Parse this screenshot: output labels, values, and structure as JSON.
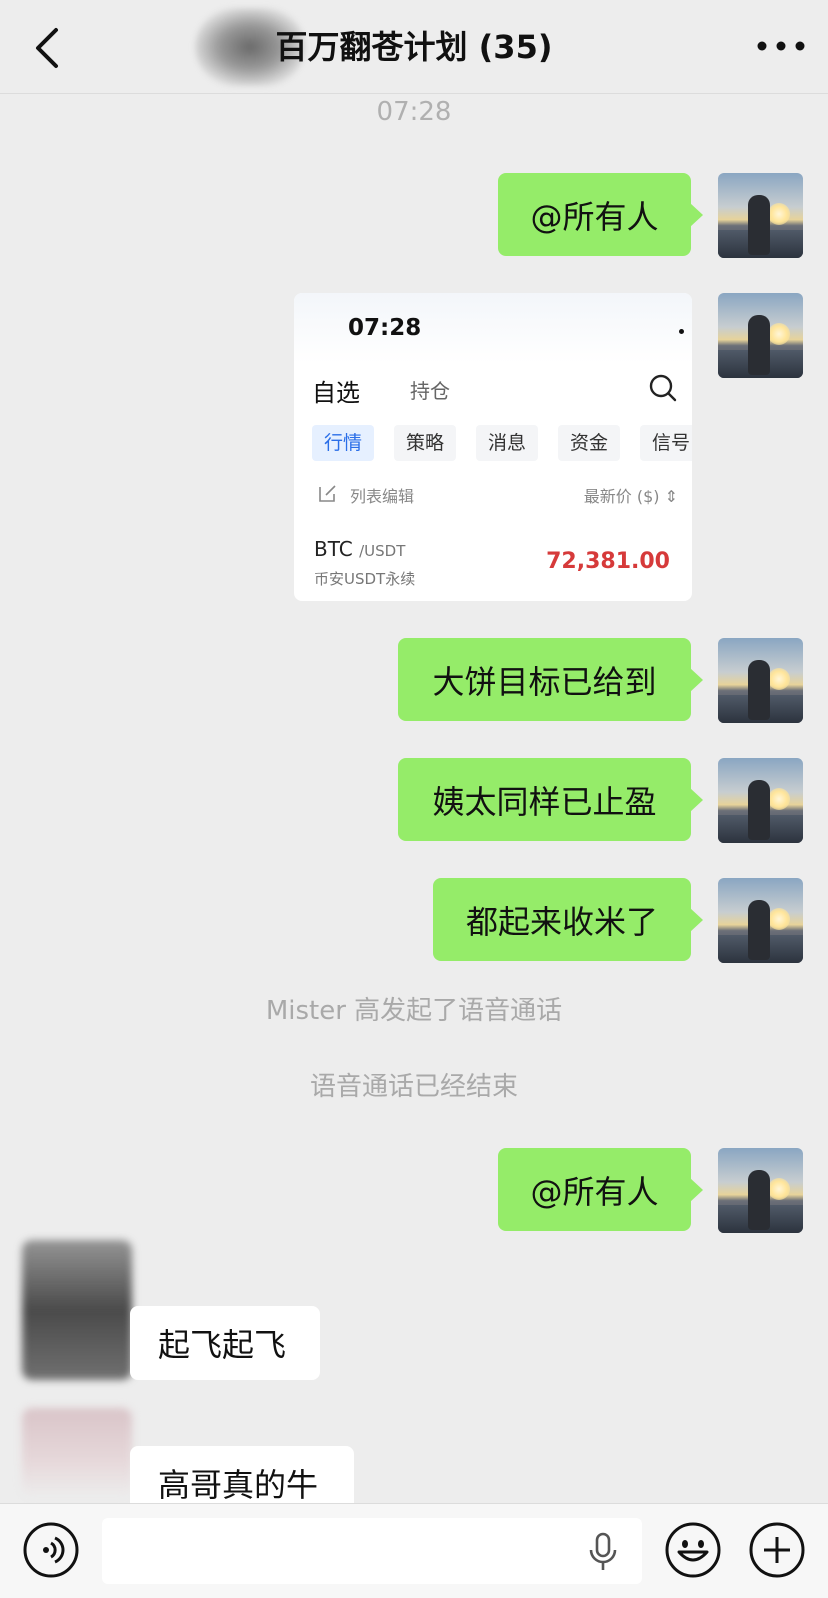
{
  "header": {
    "title": "百万翻苍计划 (35)"
  },
  "timestamp": "07:28",
  "messages": {
    "m1": "@所有人",
    "m3": "大饼目标已给到",
    "m4": "姨太同样已止盈",
    "m5": "都起来收米了",
    "sys1": "Mister 高发起了语音通话",
    "sys2": "语音通话已经结束",
    "m6": "@所有人",
    "m7": "起飞起飞",
    "m8": "高哥真的牛"
  },
  "card": {
    "time": "07:28",
    "tab_selected": "自选",
    "tab_holdings": "持仓",
    "chips": [
      "行情",
      "策略",
      "消息",
      "资金",
      "信号"
    ],
    "edit_label": "列表编辑",
    "price_header": "最新价 ($) ⇕",
    "symbol": "BTC",
    "pair": "/USDT",
    "exchange": "币安USDT永续",
    "price": "72,381.00",
    "price_color": "#d63a3a"
  },
  "colors": {
    "bubble_green": "#95ec69",
    "background": "#ededed"
  },
  "icons": [
    "back-arrow-icon",
    "more-dots-icon",
    "search-icon",
    "edit-icon",
    "voice-icon",
    "mic-icon",
    "emoji-icon",
    "plus-icon"
  ]
}
